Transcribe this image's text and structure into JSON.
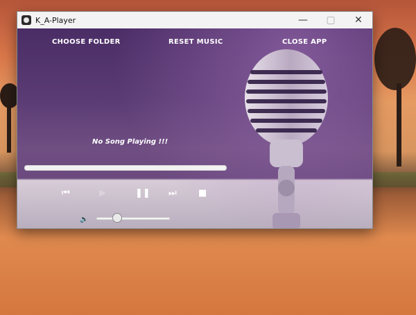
{
  "window": {
    "title": "K_A-Player"
  },
  "menu": {
    "choose_folder": "CHOOSE FOLDER",
    "reset_music": "RESET MUSIC",
    "close_app": "CLOSE APP"
  },
  "player": {
    "status": "No Song Playing !!!",
    "progress": 0,
    "volume": 0.28
  },
  "icons": {
    "prev": "previous-track-icon",
    "play": "play-icon",
    "pause": "pause-icon",
    "next": "next-track-icon",
    "stop": "stop-icon",
    "volume": "speaker-icon",
    "app": "app-icon",
    "minimize": "minimize-icon",
    "maximize": "maximize-icon",
    "close": "close-icon"
  },
  "colors": {
    "app_bg": "#5a3b73",
    "text": "#ffffff"
  }
}
